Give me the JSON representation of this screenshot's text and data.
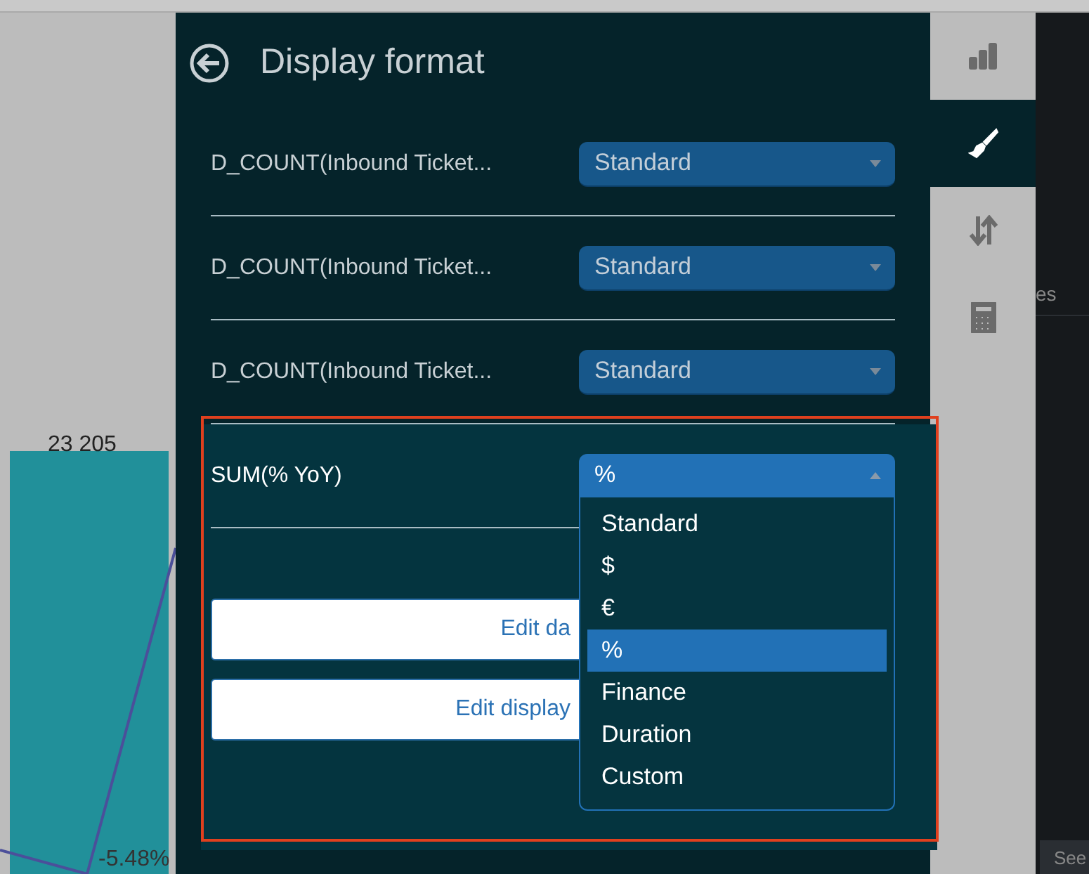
{
  "chart": {
    "bar_label": "23 205",
    "line_label": "-5.48%"
  },
  "panel": {
    "title": "Display format",
    "fields": [
      {
        "label": "D_COUNT(Inbound Ticket...",
        "value": "Standard",
        "expanded": false,
        "highlighted": false
      },
      {
        "label": "D_COUNT(Inbound Ticket...",
        "value": "Standard",
        "expanded": false,
        "highlighted": false
      },
      {
        "label": "D_COUNT(Inbound Ticket...",
        "value": "Standard",
        "expanded": false,
        "highlighted": false
      },
      {
        "label": "SUM(% YoY)",
        "value": "%",
        "expanded": true,
        "highlighted": true,
        "options": [
          {
            "label": "Standard",
            "selected": false
          },
          {
            "label": "$",
            "selected": false
          },
          {
            "label": "€",
            "selected": false
          },
          {
            "label": "%",
            "selected": true
          },
          {
            "label": "Finance",
            "selected": false
          },
          {
            "label": "Duration",
            "selected": false
          },
          {
            "label": "Custom",
            "selected": false
          }
        ]
      }
    ],
    "buttons": [
      "Edit da",
      "Edit display"
    ]
  },
  "side_tabs": [
    {
      "kind": "chart",
      "selected": false
    },
    {
      "kind": "brush",
      "selected": true
    },
    {
      "kind": "sort",
      "selected": false
    },
    {
      "kind": "calculator",
      "selected": false
    }
  ],
  "background": {
    "column_header": "es",
    "button": "See"
  }
}
